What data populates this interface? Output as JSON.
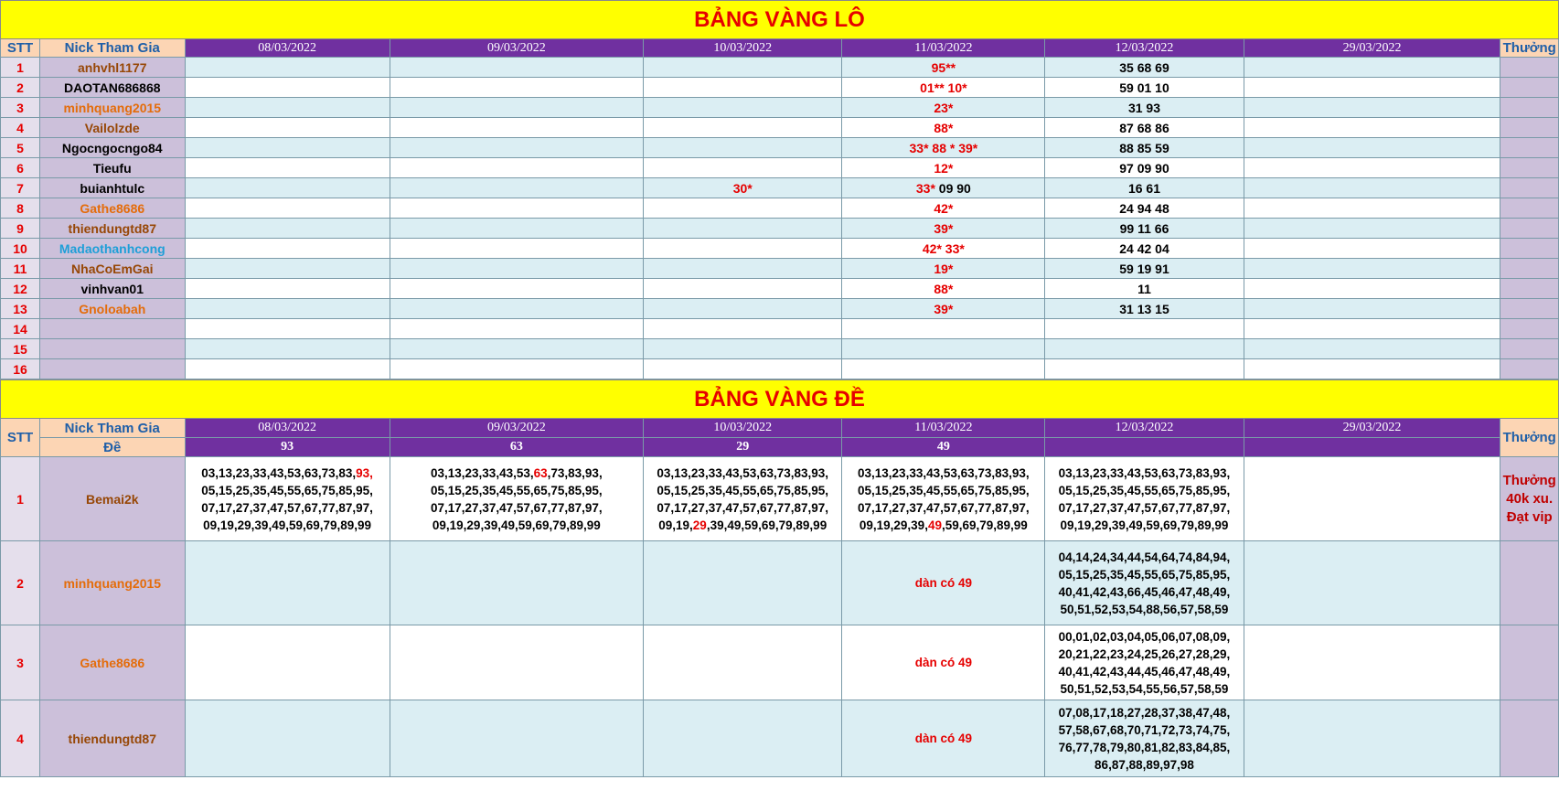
{
  "lo": {
    "title": "BẢNG VÀNG LÔ",
    "headers": {
      "stt": "STT",
      "nick": "Nick Tham Gia",
      "thuong": "Thưởng"
    },
    "dates": [
      "08/03/2022",
      "09/03/2022",
      "10/03/2022",
      "11/03/2022",
      "12/03/2022",
      "29/03/2022"
    ],
    "rows": [
      {
        "stt": "1",
        "nick": "anhvhl1177",
        "nick_color": "#974706",
        "d10": "",
        "d11": "95**",
        "d12": "35 68 69"
      },
      {
        "stt": "2",
        "nick": "DAOTAN686868",
        "nick_color": "#000000",
        "d10": "",
        "d11": "01** 10*",
        "d12": "59 01 10"
      },
      {
        "stt": "3",
        "nick": "minhquang2015",
        "nick_color": "#e46c0a",
        "d10": "",
        "d11": "23*",
        "d12": "31 93"
      },
      {
        "stt": "4",
        "nick": "Vailolzde",
        "nick_color": "#974706",
        "d10": "",
        "d11": "88*",
        "d12": "87 68 86"
      },
      {
        "stt": "5",
        "nick": "Ngocngocngo84",
        "nick_color": "#000000",
        "d10": "",
        "d11": "33* 88 * 39*",
        "d12": "88 85 59"
      },
      {
        "stt": "6",
        "nick": "Tieufu",
        "nick_color": "#000000",
        "d10": "",
        "d11": "12*",
        "d12": "97 09 90"
      },
      {
        "stt": "7",
        "nick": "buianhtulc",
        "nick_color": "#000000",
        "d10": "30*",
        "d11": "33*",
        "d11b": " 09 90",
        "d12": "16 61"
      },
      {
        "stt": "8",
        "nick": "Gathe8686",
        "nick_color": "#e46c0a",
        "d10": "",
        "d11": "42*",
        "d12": "24 94 48"
      },
      {
        "stt": "9",
        "nick": "thiendungtd87",
        "nick_color": "#974706",
        "d10": "",
        "d11": "39*",
        "d12": "99 11 66"
      },
      {
        "stt": "10",
        "nick": "Madaothanhcong",
        "nick_color": "#1e9fd8",
        "d10": "",
        "d11": "42* 33*",
        "d12": "24 42 04"
      },
      {
        "stt": "11",
        "nick": "NhaCoEmGai",
        "nick_color": "#974706",
        "d10": "",
        "d11": "19*",
        "d12": "59 19 91"
      },
      {
        "stt": "12",
        "nick": "vinhvan01",
        "nick_color": "#000000",
        "d10": "",
        "d11": "88*",
        "d12": "11"
      },
      {
        "stt": "13",
        "nick": "Gnoloabah",
        "nick_color": "#e46c0a",
        "d10": "",
        "d11": "39*",
        "d12": "31 13 15"
      },
      {
        "stt": "14",
        "nick": "",
        "nick_color": "#000000",
        "d10": "",
        "d11": "",
        "d12": ""
      },
      {
        "stt": "15",
        "nick": "",
        "nick_color": "#000000",
        "d10": "",
        "d11": "",
        "d12": ""
      },
      {
        "stt": "16",
        "nick": "",
        "nick_color": "#000000",
        "d10": "",
        "d11": "",
        "d12": ""
      }
    ]
  },
  "de": {
    "title": "BẢNG VÀNG ĐỀ",
    "headers": {
      "stt": "STT",
      "nick": "Nick Tham Gia",
      "de": "Đề",
      "thuong": "Thưởng"
    },
    "dates": [
      "08/03/2022",
      "09/03/2022",
      "10/03/2022",
      "11/03/2022",
      "12/03/2022",
      "29/03/2022"
    ],
    "results": [
      "93",
      "63",
      "29",
      "49",
      "",
      ""
    ],
    "rows": [
      {
        "stt": "1",
        "nick": "Bemai2k",
        "nick_color": "#974706",
        "d08": [
          [
            "03,13,23,33,43,53,63,73,83,",
            "93,",
            ""
          ],
          [
            "05,15,25,35,45,55,65,75,85,95,",
            "",
            ""
          ],
          [
            "07,17,27,37,47,57,67,77,87,97,",
            "",
            ""
          ],
          [
            "09,19,29,39,49,59,69,79,89,99",
            "",
            ""
          ]
        ],
        "d09": [
          [
            "03,13,23,33,43,53,",
            "63",
            ",73,83,93,"
          ],
          [
            "05,15,25,35,45,55,65,75,85,95,",
            "",
            ""
          ],
          [
            "07,17,27,37,47,57,67,77,87,97,",
            "",
            ""
          ],
          [
            "09,19,29,39,49,59,69,79,89,99",
            "",
            ""
          ]
        ],
        "d10": [
          [
            "03,13,23,33,43,53,63,73,83,93,",
            "",
            ""
          ],
          [
            "05,15,25,35,45,55,65,75,85,95,",
            "",
            ""
          ],
          [
            "07,17,27,37,47,57,67,77,87,97,",
            "",
            ""
          ],
          [
            "09,19,",
            "29",
            ",39,49,59,69,79,89,99"
          ]
        ],
        "d11": [
          [
            "03,13,23,33,43,53,63,73,83,93,",
            "",
            ""
          ],
          [
            "05,15,25,35,45,55,65,75,85,95,",
            "",
            ""
          ],
          [
            "07,17,27,37,47,57,67,77,87,97,",
            "",
            ""
          ],
          [
            "09,19,29,39,",
            "49",
            ",59,69,79,89,99"
          ]
        ],
        "d12": [
          "03,13,23,33,43,53,63,73,83,93,",
          "05,15,25,35,45,55,65,75,85,95,",
          "07,17,27,37,47,57,67,77,87,97,",
          "09,19,29,39,49,59,69,79,89,99"
        ],
        "thuong": [
          "Thưởng 40k xu.",
          "Đạt vip"
        ]
      },
      {
        "stt": "2",
        "nick": "minhquang2015",
        "nick_color": "#e46c0a",
        "d11_note": "dàn có 49",
        "d12": [
          "04,14,24,34,44,54,64,74,84,94,",
          "05,15,25,35,45,55,65,75,85,95,",
          "40,41,42,43,66,45,46,47,48,49,",
          "50,51,52,53,54,88,56,57,58,59"
        ]
      },
      {
        "stt": "3",
        "nick": "Gathe8686",
        "nick_color": "#e46c0a",
        "d11_note": "dàn có 49",
        "d12": [
          "00,01,02,03,04,05,06,07,08,09,",
          "20,21,22,23,24,25,26,27,28,29,",
          "40,41,42,43,44,45,46,47,48,49,",
          "50,51,52,53,54,55,56,57,58,59"
        ]
      },
      {
        "stt": "4",
        "nick": "thiendungtd87",
        "nick_color": "#974706",
        "d11_note": "dàn có 49",
        "d12": [
          "07,08,17,18,27,28,37,38,47,48,",
          "57,58,67,68,70,71,72,73,74,75,",
          "76,77,78,79,80,81,82,83,84,85,",
          "86,87,88,89,97,98"
        ]
      }
    ]
  }
}
